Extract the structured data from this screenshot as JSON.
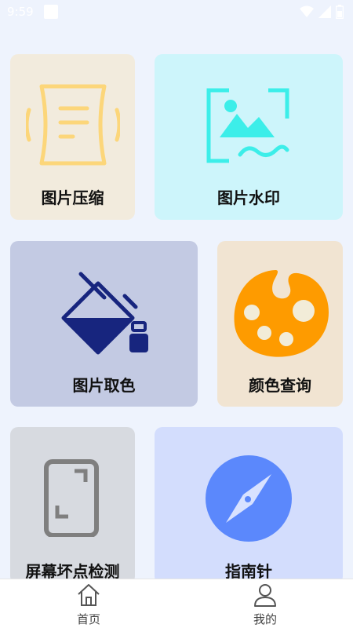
{
  "status_bar": {
    "time": "9:59"
  },
  "cards": {
    "compress": {
      "label": "图片压缩",
      "bg": "#f2ebdd"
    },
    "watermark": {
      "label": "图片水印",
      "bg": "#cdf5fb"
    },
    "pick_color": {
      "label": "图片取色",
      "bg": "#c3cae3"
    },
    "color_lookup": {
      "label": "颜色查询",
      "bg": "#f1e4d2"
    },
    "dead_pixel": {
      "label": "屏幕坏点检测",
      "bg": "#d7dae0"
    },
    "compass": {
      "label": "指南针",
      "bg": "#d3ddfd"
    }
  },
  "tabs": {
    "home": {
      "label": "首页"
    },
    "mine": {
      "label": "我的"
    }
  }
}
